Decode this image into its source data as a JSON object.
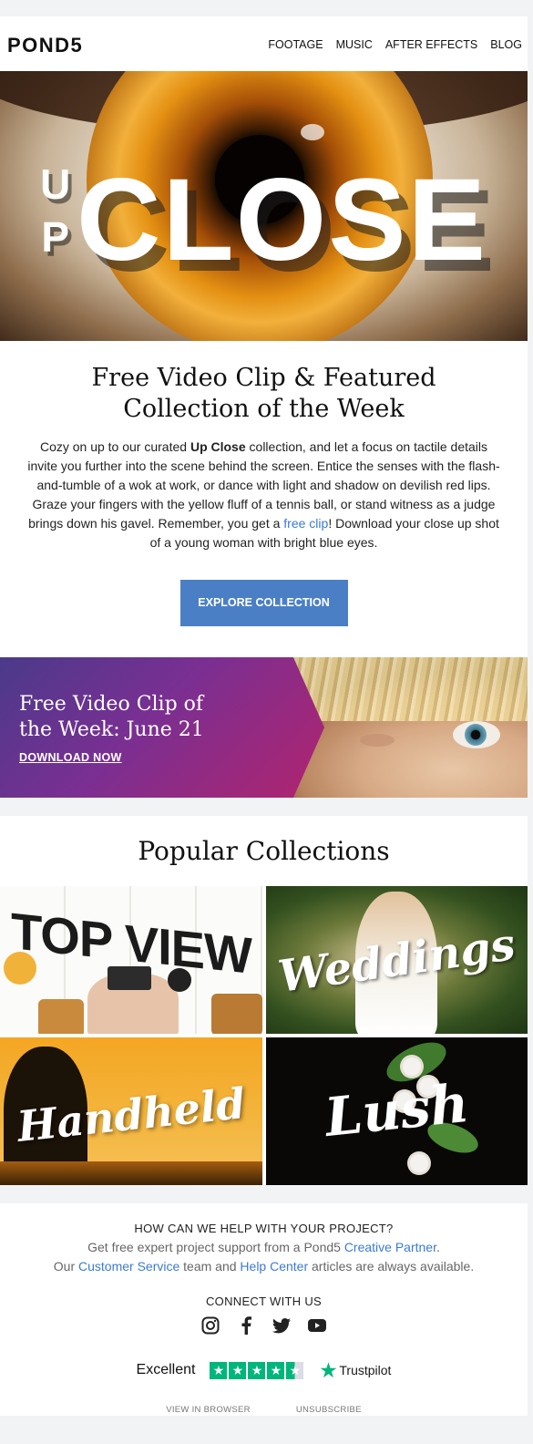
{
  "header": {
    "logo": "POND5",
    "nav": [
      "FOOTAGE",
      "MUSIC",
      "AFTER EFFECTS",
      "BLOG"
    ]
  },
  "hero": {
    "word_up": "UP",
    "word_close": "CLOSE"
  },
  "intro": {
    "title": "Free Video Clip & Featured Collection of the Week",
    "text_1": "Cozy on up to our curated ",
    "bold": "Up Close",
    "text_2": " collection, and let a focus on tactile details invite you further into the scene behind the screen. Entice the senses with the flash-and-tumble of a wok at work, or dance with light and shadow on devilish red lips. Graze your fingers with the yellow fluff of a tennis ball, or stand witness as a judge brings down his gavel. Remember, you get a ",
    "link": "free clip",
    "text_3": "! Download your close up shot of a young woman with bright blue eyes.",
    "button": "EXPLORE COLLECTION"
  },
  "clip_banner": {
    "title_line1": "Free Video Clip of",
    "title_line2": "the Week: June 21",
    "cta": "DOWNLOAD NOW"
  },
  "popular": {
    "title": "Popular Collections",
    "tiles": [
      "TOP VIEW",
      "Weddings",
      "Handheld",
      "Lush"
    ]
  },
  "footer": {
    "help_title": "HOW CAN WE HELP WITH YOUR PROJECT?",
    "line1_text": "Get free expert project support from a Pond5 ",
    "line1_link": "Creative Partner",
    "line1_end": ".",
    "line2_start": "Our ",
    "line2_link1": "Customer Service",
    "line2_mid": " team and ",
    "line2_link2": "Help Center",
    "line2_end": " articles are always available.",
    "connect": "CONNECT WITH US",
    "social_icons": [
      "instagram-icon",
      "facebook-icon",
      "twitter-icon",
      "youtube-icon"
    ],
    "trust_rating": "Excellent",
    "trust_brand": "Trustpilot",
    "trust_stars": 4.5,
    "view_in_browser": "VIEW IN BROWSER",
    "unsubscribe": "UNSUBSCRIBE"
  },
  "colors": {
    "button_blue": "#4a7fc5",
    "link_blue": "#3a7bd5",
    "trustpilot_green": "#00b67a"
  }
}
